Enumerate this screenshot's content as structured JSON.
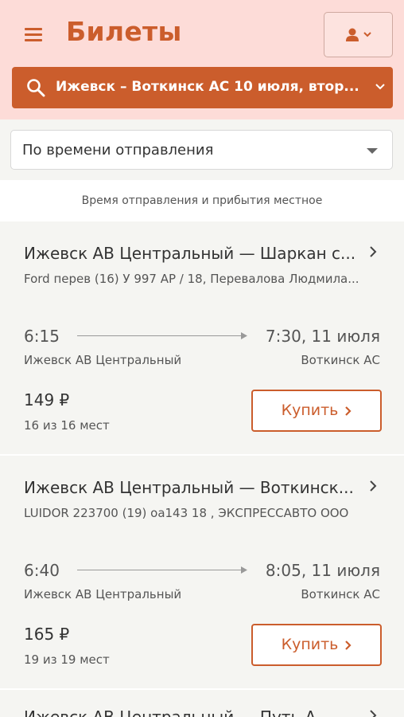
{
  "header": {
    "title": "Билеты",
    "search": "Ижевск – Воткинск АС  10 июля, втор..."
  },
  "sort": {
    "selected": "По времени отправления"
  },
  "note": "Время отправления и прибытия местное",
  "trips": [
    {
      "route": "Ижевск АВ Центральный — Шаркан с...",
      "vehicle": "Ford перев (16) У 997 АР / 18, Перевалова Людмила...",
      "dep_time": "6:15",
      "arr_time": "7:30, 11 июля",
      "dep_station": "Ижевск АВ Центральный",
      "arr_station": "Воткинск АС",
      "price": "149 ₽",
      "seats": "16 из 16 мест",
      "buy_label": "Купить"
    },
    {
      "route": "Ижевск АВ Центральный — Воткинск...",
      "vehicle": "LUIDOR 223700 (19) оа143 18 , ЭКСПРЕССАВТО ООО",
      "dep_time": "6:40",
      "arr_time": "8:05, 11 июля",
      "dep_station": "Ижевск АВ Центральный",
      "arr_station": "Воткинск АС",
      "price": "165 ₽",
      "seats": "19 из 19 мест",
      "buy_label": "Купить"
    },
    {
      "route": "Ижевск АВ Центральный — Путь А..."
    }
  ],
  "colors": {
    "accent": "#cb5d2c",
    "header_bg": "#fddcd8",
    "card_bg": "#f5f5f2"
  },
  "icons": {
    "menu": "hamburger-menu-icon",
    "user": "user-icon",
    "search": "search-icon",
    "chevron_down": "chevron-down-icon",
    "chevron_right": "chevron-right-icon",
    "arrow": "arrow-right-icon"
  }
}
